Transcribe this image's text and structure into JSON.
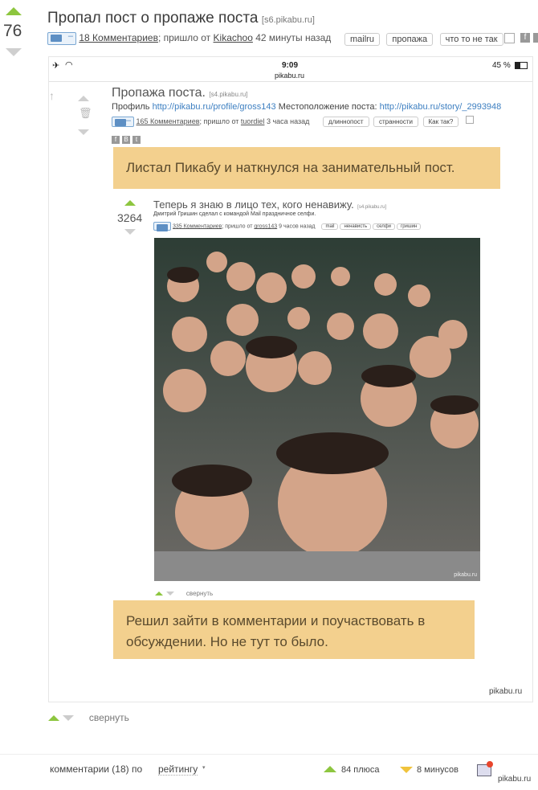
{
  "post": {
    "score": "76",
    "title": "Пропал пост о пропаже поста",
    "domain": "[s6.pikabu.ru]",
    "comments": "18 Комментариев",
    "from_text": "; пришло от",
    "author": "Kikachoo",
    "time": "42 минуты назад",
    "tags": [
      "mailru",
      "пропажа",
      "что то не так"
    ]
  },
  "status_bar": {
    "time": "9:09",
    "url": "pikabu.ru",
    "battery": "45 %"
  },
  "inner_post": {
    "title": "Пропажа поста.",
    "domain": "[s4.pikabu.ru]",
    "profile_label": "Профиль",
    "profile_url": "http://pikabu.ru/profile/gross143",
    "location_label": "Местоположение поста:",
    "location_url": "http://pikabu.ru/story/_2993948",
    "comments": "165 Комментариев",
    "from_text": "; пришло от",
    "author": "tuordiel",
    "time": "3 часа назад",
    "tags": [
      "длиннопост",
      "странности",
      "Как так?"
    ]
  },
  "caption1": "Листал Пикабу и наткнулся на занимательный пост.",
  "nested_post": {
    "score": "3264",
    "title": "Теперь я знаю в лицо тех, кого ненавижу.",
    "domain": "[s4.pikabu.ru]",
    "subtitle": "Дмитрий Гришин сделал с командой Mail праздничное селфи.",
    "comments": "335 Комментариев",
    "from_text": "; пришло от",
    "author": "gross143",
    "time": "9 часов назад",
    "tags": [
      "mail",
      "ненависть",
      "селфи",
      "гришин"
    ],
    "collapse": "свернуть",
    "photo_watermark": "pikabu.ru"
  },
  "caption2": "Решил зайти в комментарии и поучаствовать в обсуждении. Но не тут то было.",
  "image_watermark": "pikabu.ru",
  "collapse": "свернуть",
  "footer": {
    "comments_label": "комментарии (18) по",
    "sort": "рейтингу",
    "plus": "84 плюса",
    "minus": "8 минусов",
    "watermark": "pikabu.ru"
  }
}
